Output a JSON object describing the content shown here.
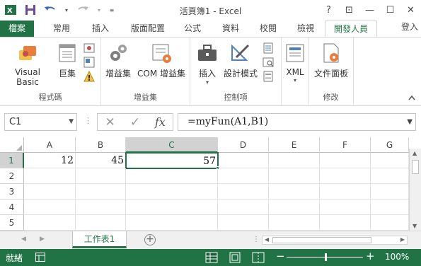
{
  "window": {
    "title": "活頁簿1 - Excel",
    "controls": {
      "help": "?",
      "ribbon_options": "⊡",
      "minimize": "—",
      "restore": "☐",
      "close": "✕"
    }
  },
  "tabs": {
    "file": "檔案",
    "items": [
      "常用",
      "插入",
      "版面配置",
      "公式",
      "資料",
      "校閱",
      "檢視",
      "開發人員"
    ],
    "active": "開發人員",
    "signin": "登入"
  },
  "ribbon": {
    "groups": [
      {
        "label": "程式碼",
        "buttons": [
          "Visual Basic",
          "巨集"
        ]
      },
      {
        "label": "增益集",
        "buttons": [
          "增益集",
          "COM 增益集"
        ]
      },
      {
        "label": "控制項",
        "buttons": [
          "插入",
          "設計模式"
        ]
      },
      {
        "label": "",
        "buttons": [
          "XML"
        ]
      },
      {
        "label": "修改",
        "buttons": [
          "文件面板"
        ]
      }
    ]
  },
  "formula_bar": {
    "name_box": "C1",
    "formula": "=myFun(A1,B1)"
  },
  "grid": {
    "columns": [
      "A",
      "B",
      "C",
      "D",
      "E",
      "F",
      "G"
    ],
    "rows": [
      "1",
      "2",
      "3",
      "4",
      "5"
    ],
    "selected_column": "C",
    "selected_row": "1",
    "cells": {
      "A1": "12",
      "B1": "45",
      "C1": "57"
    }
  },
  "sheets": {
    "tabs": [
      "工作表1"
    ],
    "active": "工作表1"
  },
  "status": {
    "ready": "就緒",
    "zoom": "100%"
  },
  "colors": {
    "accent": "#217346",
    "header_selected": "#d2d2d2"
  }
}
